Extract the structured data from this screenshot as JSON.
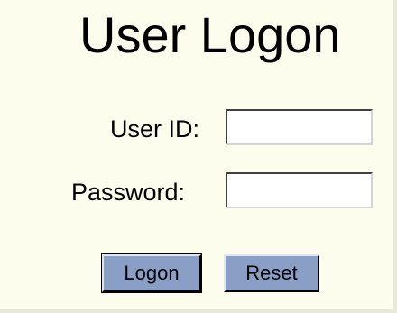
{
  "title": "User Logon",
  "form": {
    "user_id_label": "User ID:",
    "user_id_value": "",
    "password_label": "Password:",
    "password_value": ""
  },
  "buttons": {
    "logon_label": "Logon",
    "reset_label": "Reset"
  }
}
